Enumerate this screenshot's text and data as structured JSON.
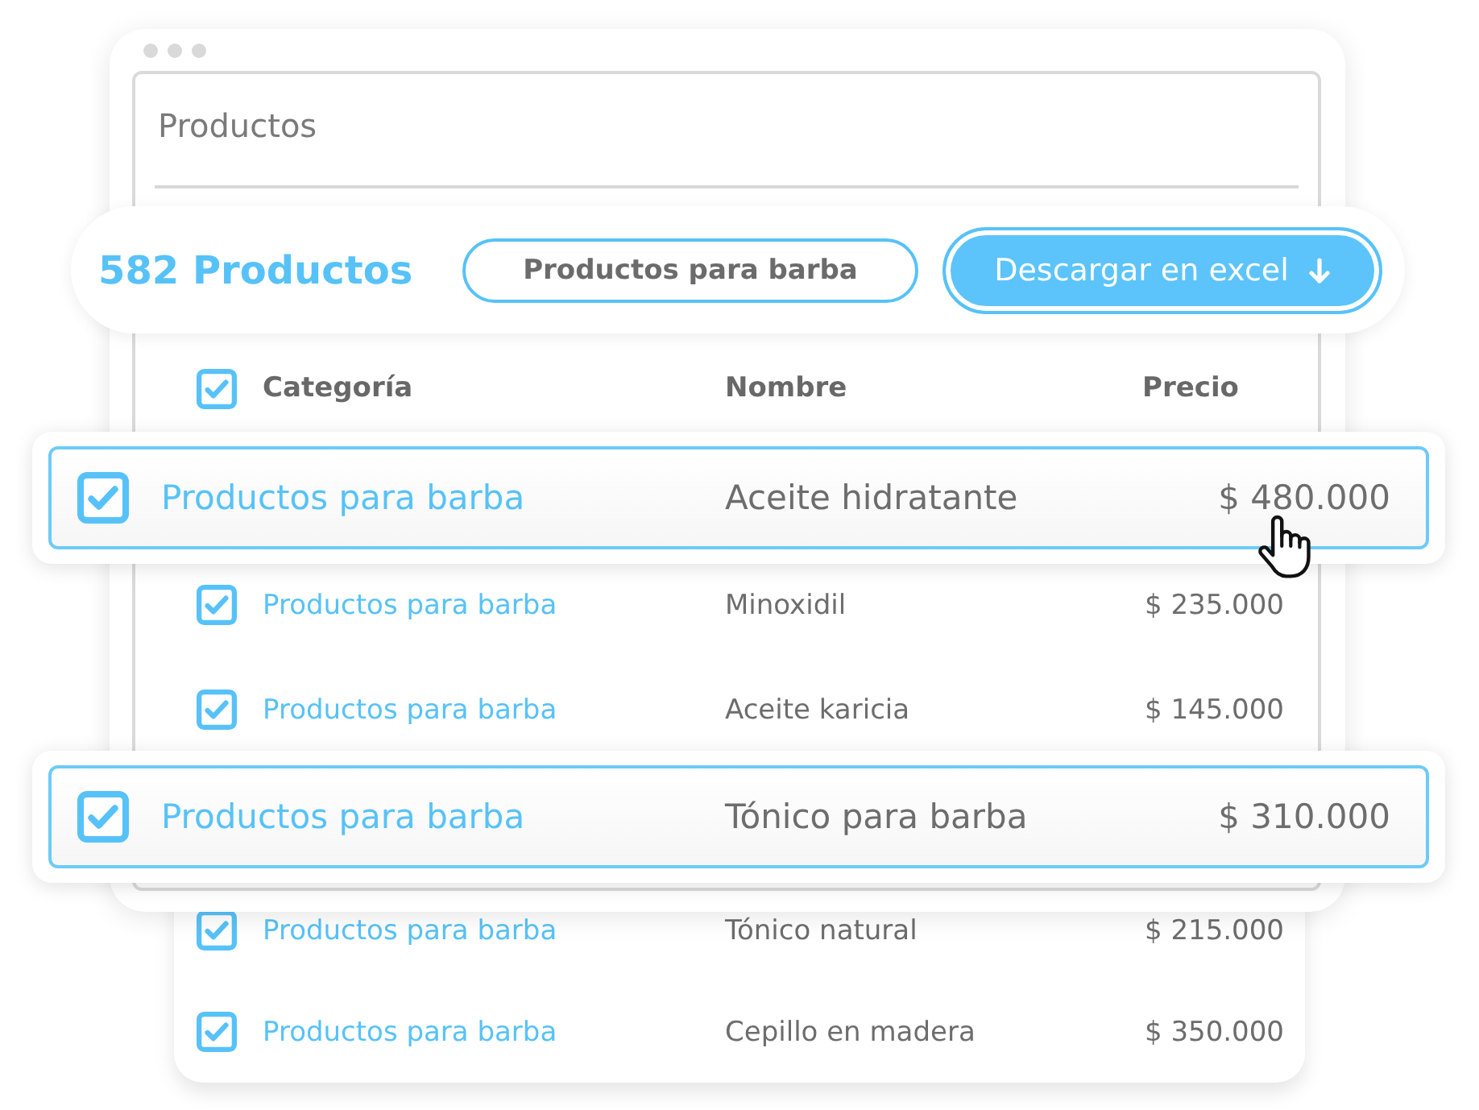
{
  "window": {
    "title": "Productos"
  },
  "toolbar": {
    "count": "582 Productos",
    "filter_button": "Productos para barba",
    "download_button": "Descargar en excel"
  },
  "table": {
    "header": {
      "checked": true,
      "columns": [
        "Categoría",
        "Nombre",
        "Precio"
      ]
    },
    "rows": [
      {
        "category": "Productos para barba",
        "name": "Aceite hidratante",
        "price": "$ 480.000",
        "checked": true,
        "highlighted": true,
        "hovered": true
      },
      {
        "category": "Productos para barba",
        "name": "Minoxidil",
        "price": "$ 235.000",
        "checked": true,
        "highlighted": false,
        "hovered": false
      },
      {
        "category": "Productos para barba",
        "name": "Aceite karicia",
        "price": "$ 145.000",
        "checked": true,
        "highlighted": false,
        "hovered": false
      },
      {
        "category": "Productos para barba",
        "name": "Tónico para barba",
        "price": "$ 310.000",
        "checked": true,
        "highlighted": true,
        "hovered": false
      },
      {
        "category": "Productos para barba",
        "name": "Tónico natural",
        "price": "$ 215.000",
        "checked": true,
        "highlighted": false,
        "hovered": false
      },
      {
        "category": "Productos para barba",
        "name": "Cepillo en madera",
        "price": "$ 350.000",
        "checked": true,
        "highlighted": false,
        "hovered": false
      }
    ]
  }
}
